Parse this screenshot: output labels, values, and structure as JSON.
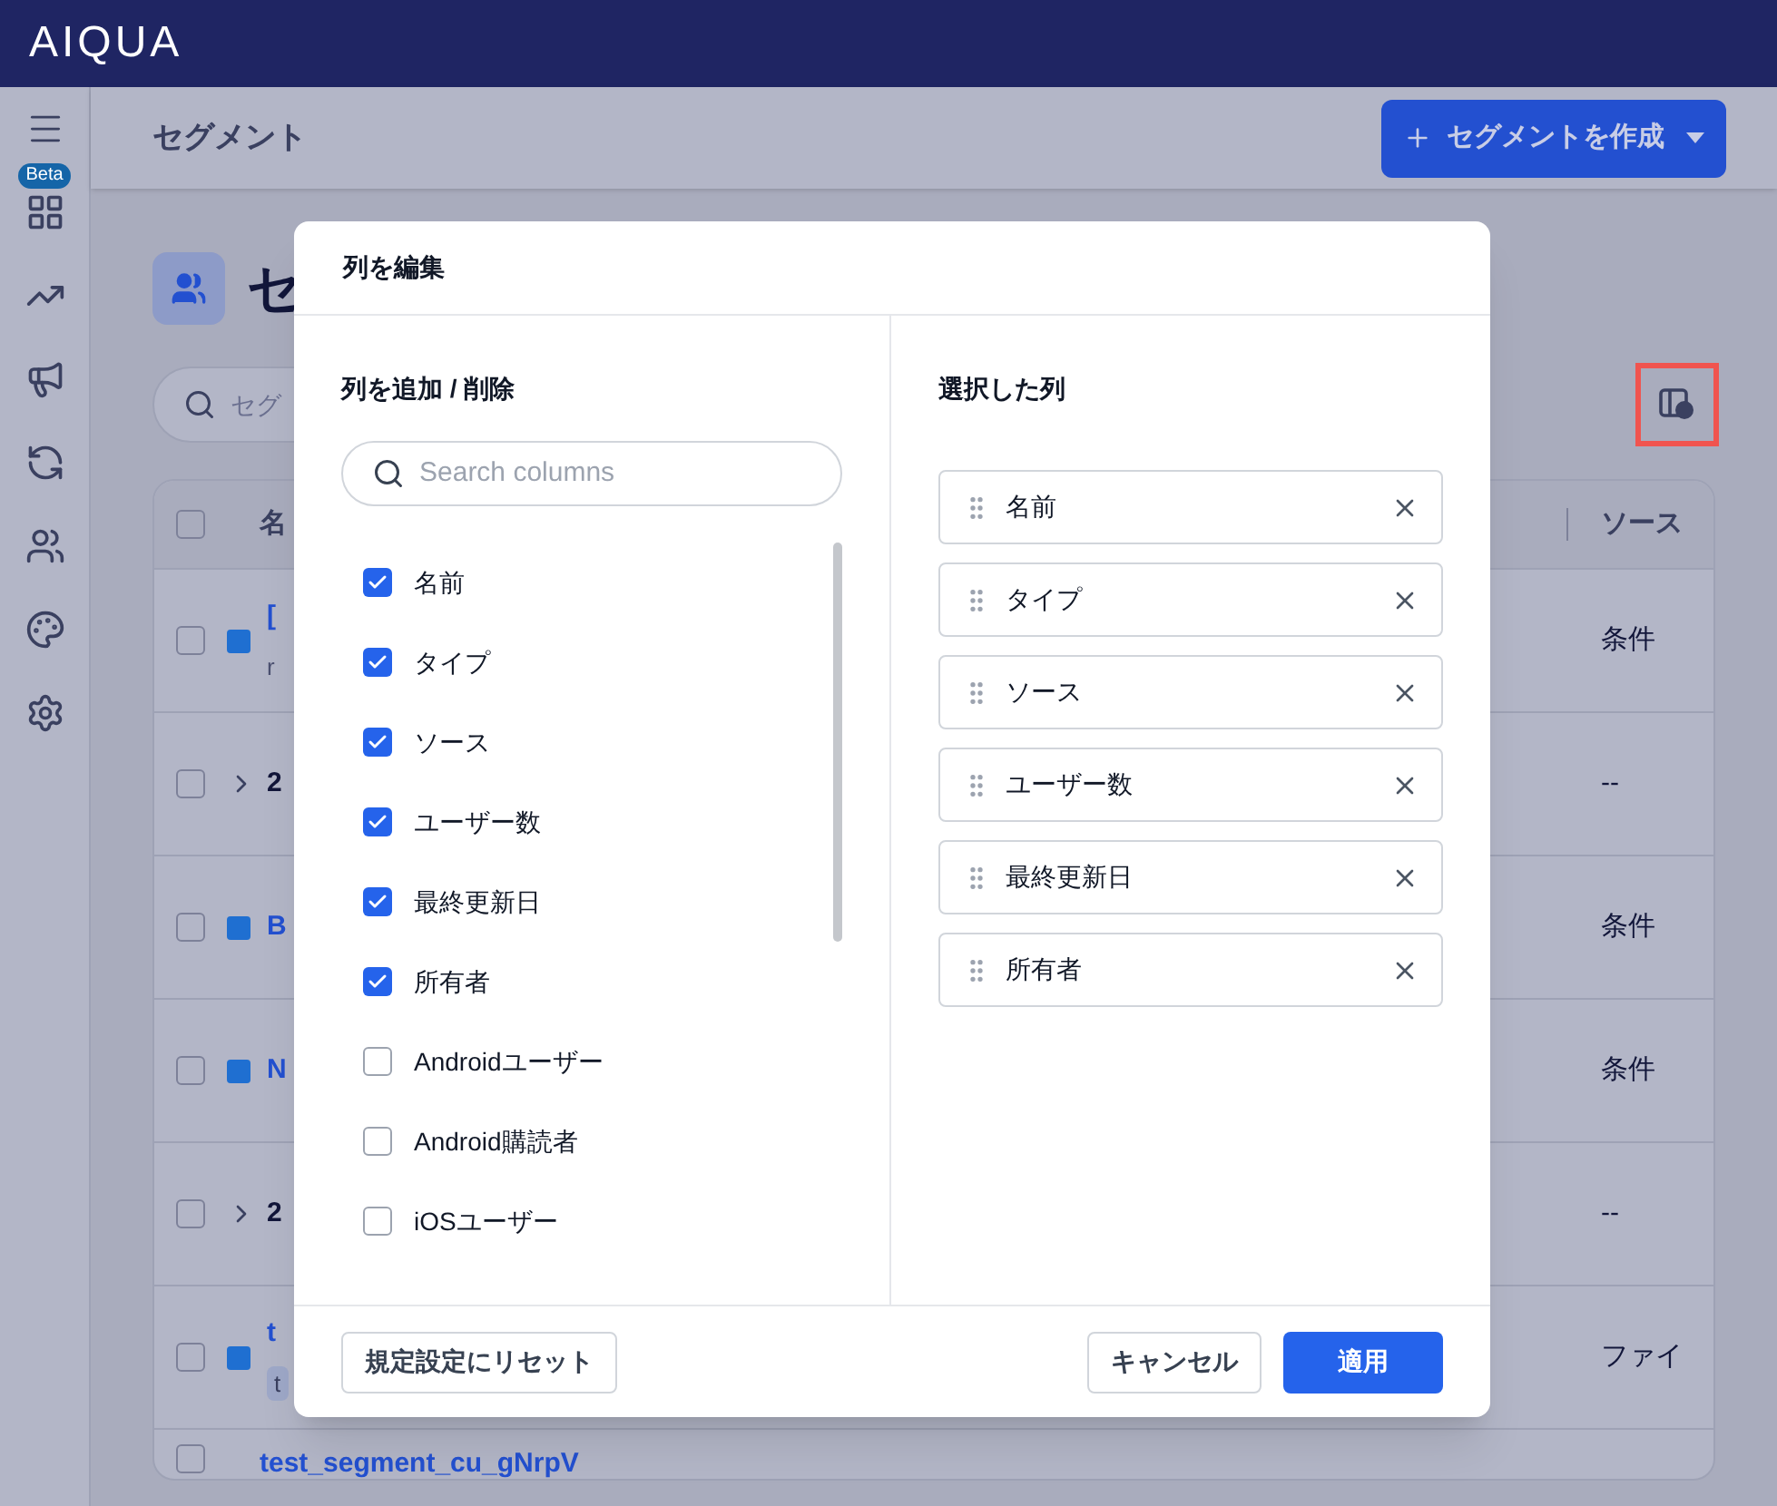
{
  "app": {
    "logo": "AIQUA"
  },
  "sidebar": {
    "beta_badge": "Beta"
  },
  "header": {
    "title": "セグメント",
    "create_button": "セグメントを作成"
  },
  "page": {
    "title": "セ",
    "search": {
      "placeholder": "セグ"
    }
  },
  "table": {
    "header_checked": false,
    "columns": [
      "名",
      "ソース"
    ],
    "rows": [
      {
        "kind": "segment",
        "checked": false,
        "name": "[",
        "subtitle": "r",
        "source": "条件"
      },
      {
        "kind": "group",
        "checked": false,
        "name": "2",
        "source": "--"
      },
      {
        "kind": "segment",
        "checked": false,
        "name": "B",
        "source": "条件"
      },
      {
        "kind": "segment",
        "checked": false,
        "name": "N",
        "source": "条件"
      },
      {
        "kind": "group",
        "checked": false,
        "name": "2",
        "source": "--"
      },
      {
        "kind": "segment",
        "checked": false,
        "name": "t",
        "tag": "t",
        "source": "ファイ"
      },
      {
        "kind": "segment",
        "checked": false,
        "name": "test_segment_cu_gNrpV"
      }
    ]
  },
  "dialog": {
    "title": "列を編集",
    "add_remove": {
      "title": "列を追加 / 削除",
      "search": {
        "placeholder": "Search columns"
      },
      "columns": [
        {
          "label": "名前",
          "checked": true
        },
        {
          "label": "タイプ",
          "checked": true
        },
        {
          "label": "ソース",
          "checked": true
        },
        {
          "label": "ユーザー数",
          "checked": true
        },
        {
          "label": "最終更新日",
          "checked": true
        },
        {
          "label": "所有者",
          "checked": true
        },
        {
          "label": "Androidユーザー",
          "checked": false
        },
        {
          "label": "Android購読者",
          "checked": false
        },
        {
          "label": "iOSユーザー",
          "checked": false
        }
      ]
    },
    "selected": {
      "title": "選択した列",
      "columns": [
        "名前",
        "タイプ",
        "ソース",
        "ユーザー数",
        "最終更新日",
        "所有者"
      ]
    },
    "buttons": {
      "reset": "規定設定にリセット",
      "cancel": "キャンセル",
      "apply": "適用"
    }
  }
}
